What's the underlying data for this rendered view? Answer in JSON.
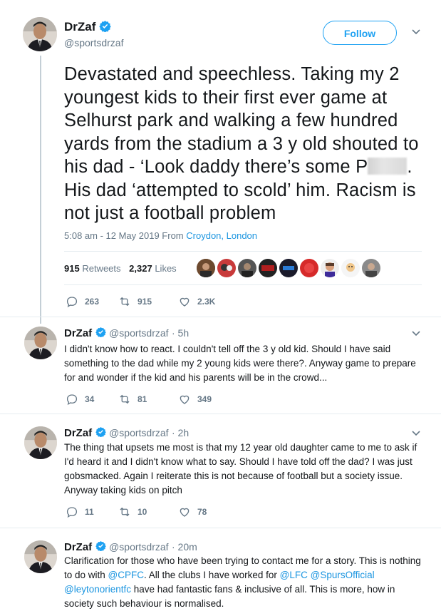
{
  "main_tweet": {
    "name": "DrZaf",
    "handle": "@sportsdrzaf",
    "follow_label": "Follow",
    "text_part1": "Devastated and speechless. Taking my 2 youngest kids to their first ever game at Selhurst park and walking a few hundred yards from the stadium a 3 y old shouted to his dad - ‘Look daddy there’s some P",
    "text_part2": ". His dad ‘attempted to scold’ him. Racism is not just a football problem",
    "timestamp": "5:08 am - 12 May 2019 From",
    "location": "Croydon, London",
    "retweets_count": "915",
    "retweets_label": "Retweets",
    "likes_count": "2,327",
    "likes_label": "Likes",
    "actions": {
      "replies": "263",
      "retweets": "915",
      "likes": "2.3K"
    }
  },
  "replies": [
    {
      "name": "DrZaf",
      "handle": "@sportsdrzaf",
      "time": "· 5h",
      "text": "I didn't know how to react. I couldn't tell off the 3 y old kid. Should I have said something to the dad while my 2 young kids were there?. Anyway game to prepare for and wonder if the kid and his parents will be in the crowd...",
      "actions": {
        "replies": "34",
        "retweets": "81",
        "likes": "349"
      }
    },
    {
      "name": "DrZaf",
      "handle": "@sportsdrzaf",
      "time": "· 2h",
      "text": "The thing that upsets me most is that my 12 year old daughter came to me to ask if I'd heard it and I didn't know what to say. Should I have told off the dad? I was just gobsmacked. Again I reiterate this is not because of football but a society issue. Anyway taking kids on pitch",
      "actions": {
        "replies": "11",
        "retweets": "10",
        "likes": "78"
      }
    },
    {
      "name": "DrZaf",
      "handle": "@sportsdrzaf",
      "time": "· 20m",
      "text_a": "Clarification for those who have been trying to contact me for a story. This is nothing to do with ",
      "mention1": "@CPFC",
      "text_b": ". All the clubs I have worked for ",
      "mention2": "@LFC",
      "mention3": "@SpursOfficial",
      "mention4": "@leytonorientfc",
      "text_c": " have had fantastic fans & inclusive of all. This is more, how in society such behaviour is normalised."
    }
  ],
  "icons": {
    "verified": "verified-badge-icon",
    "reply": "reply-icon",
    "retweet": "retweet-icon",
    "like": "heart-icon",
    "more": "chevron-down-icon"
  },
  "colors": {
    "accent": "#1da1f2",
    "link": "#1b95e0",
    "muted": "#657786",
    "text": "#14171a"
  }
}
